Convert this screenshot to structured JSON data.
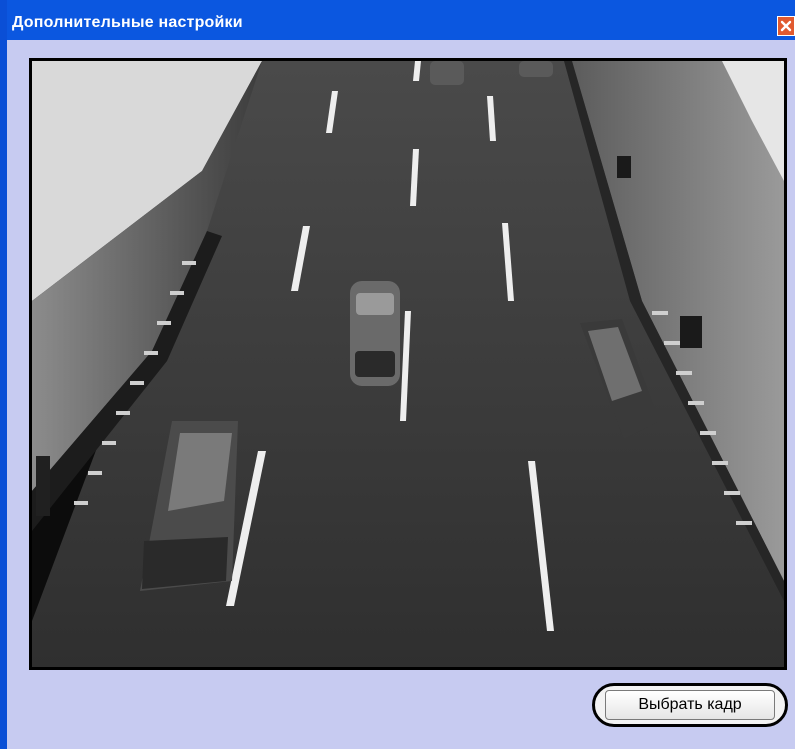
{
  "window": {
    "title": "Дополнительные настройки"
  },
  "icons": {
    "close": "close-icon"
  },
  "preview": {
    "description_icon": "camera-frame"
  },
  "buttons": {
    "select_frame": "Выбрать кадр"
  },
  "colors": {
    "titlebar": "#0b57e0",
    "window_bg": "#c7cbf1",
    "close_button": "#e15a30"
  }
}
